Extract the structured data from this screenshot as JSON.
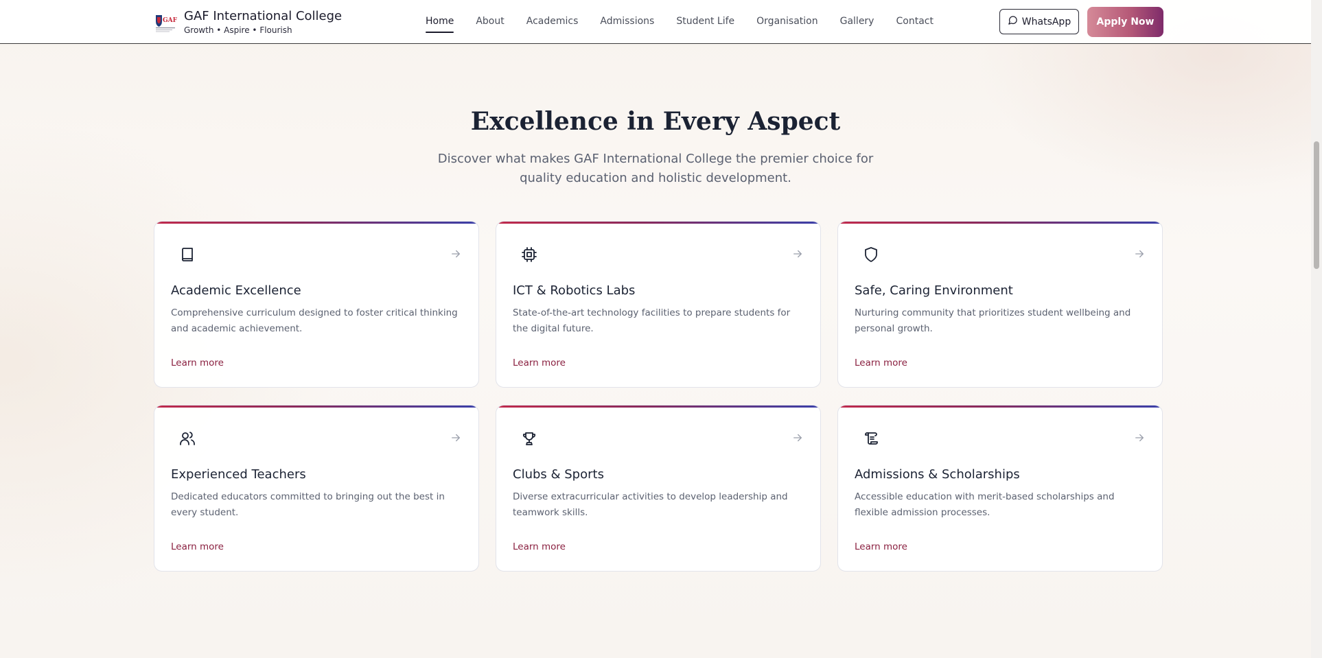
{
  "header": {
    "brand_name": "GAF International College",
    "brand_tagline": "Growth • Aspire • Flourish",
    "logo_icon": "college-crest-icon",
    "nav": [
      {
        "label": "Home",
        "active": true
      },
      {
        "label": "About"
      },
      {
        "label": "Academics"
      },
      {
        "label": "Admissions"
      },
      {
        "label": "Student Life"
      },
      {
        "label": "Organisation"
      },
      {
        "label": "Gallery"
      },
      {
        "label": "Contact"
      }
    ],
    "whatsapp_label": "WhatsApp",
    "whatsapp_icon": "chat-bubble-icon",
    "apply_label": "Apply Now"
  },
  "section": {
    "title": "Excellence in Every Aspect",
    "subtitle": "Discover what makes GAF International College the premier choice for quality education and holistic development."
  },
  "cards": [
    {
      "icon": "book-icon",
      "title": "Academic Excellence",
      "description": "Comprehensive curriculum designed to foster critical thinking and academic achievement.",
      "link": "Learn more"
    },
    {
      "icon": "cpu-chip-icon",
      "title": "ICT & Robotics Labs",
      "description": "State-of-the-art technology facilities to prepare students for the digital future.",
      "link": "Learn more"
    },
    {
      "icon": "shield-icon",
      "title": "Safe, Caring Environment",
      "description": "Nurturing community that prioritizes student wellbeing and personal growth.",
      "link": "Learn more"
    },
    {
      "icon": "users-icon",
      "title": "Experienced Teachers",
      "description": "Dedicated educators committed to bringing out the best in every student.",
      "link": "Learn more"
    },
    {
      "icon": "trophy-icon",
      "title": "Clubs & Sports",
      "description": "Diverse extracurricular activities to develop leadership and teamwork skills.",
      "link": "Learn more"
    },
    {
      "icon": "scroll-icon",
      "title": "Admissions & Scholarships",
      "description": "Accessible education with merit-based scholarships and flexible admission processes.",
      "link": "Learn more"
    }
  ],
  "colors": {
    "brand_gradient_start": "#d58a98",
    "brand_gradient_end": "#7e2b6a",
    "link": "#8a2040",
    "card_accent_left": "#c02a4c",
    "card_accent_right": "#3a3fa8"
  }
}
